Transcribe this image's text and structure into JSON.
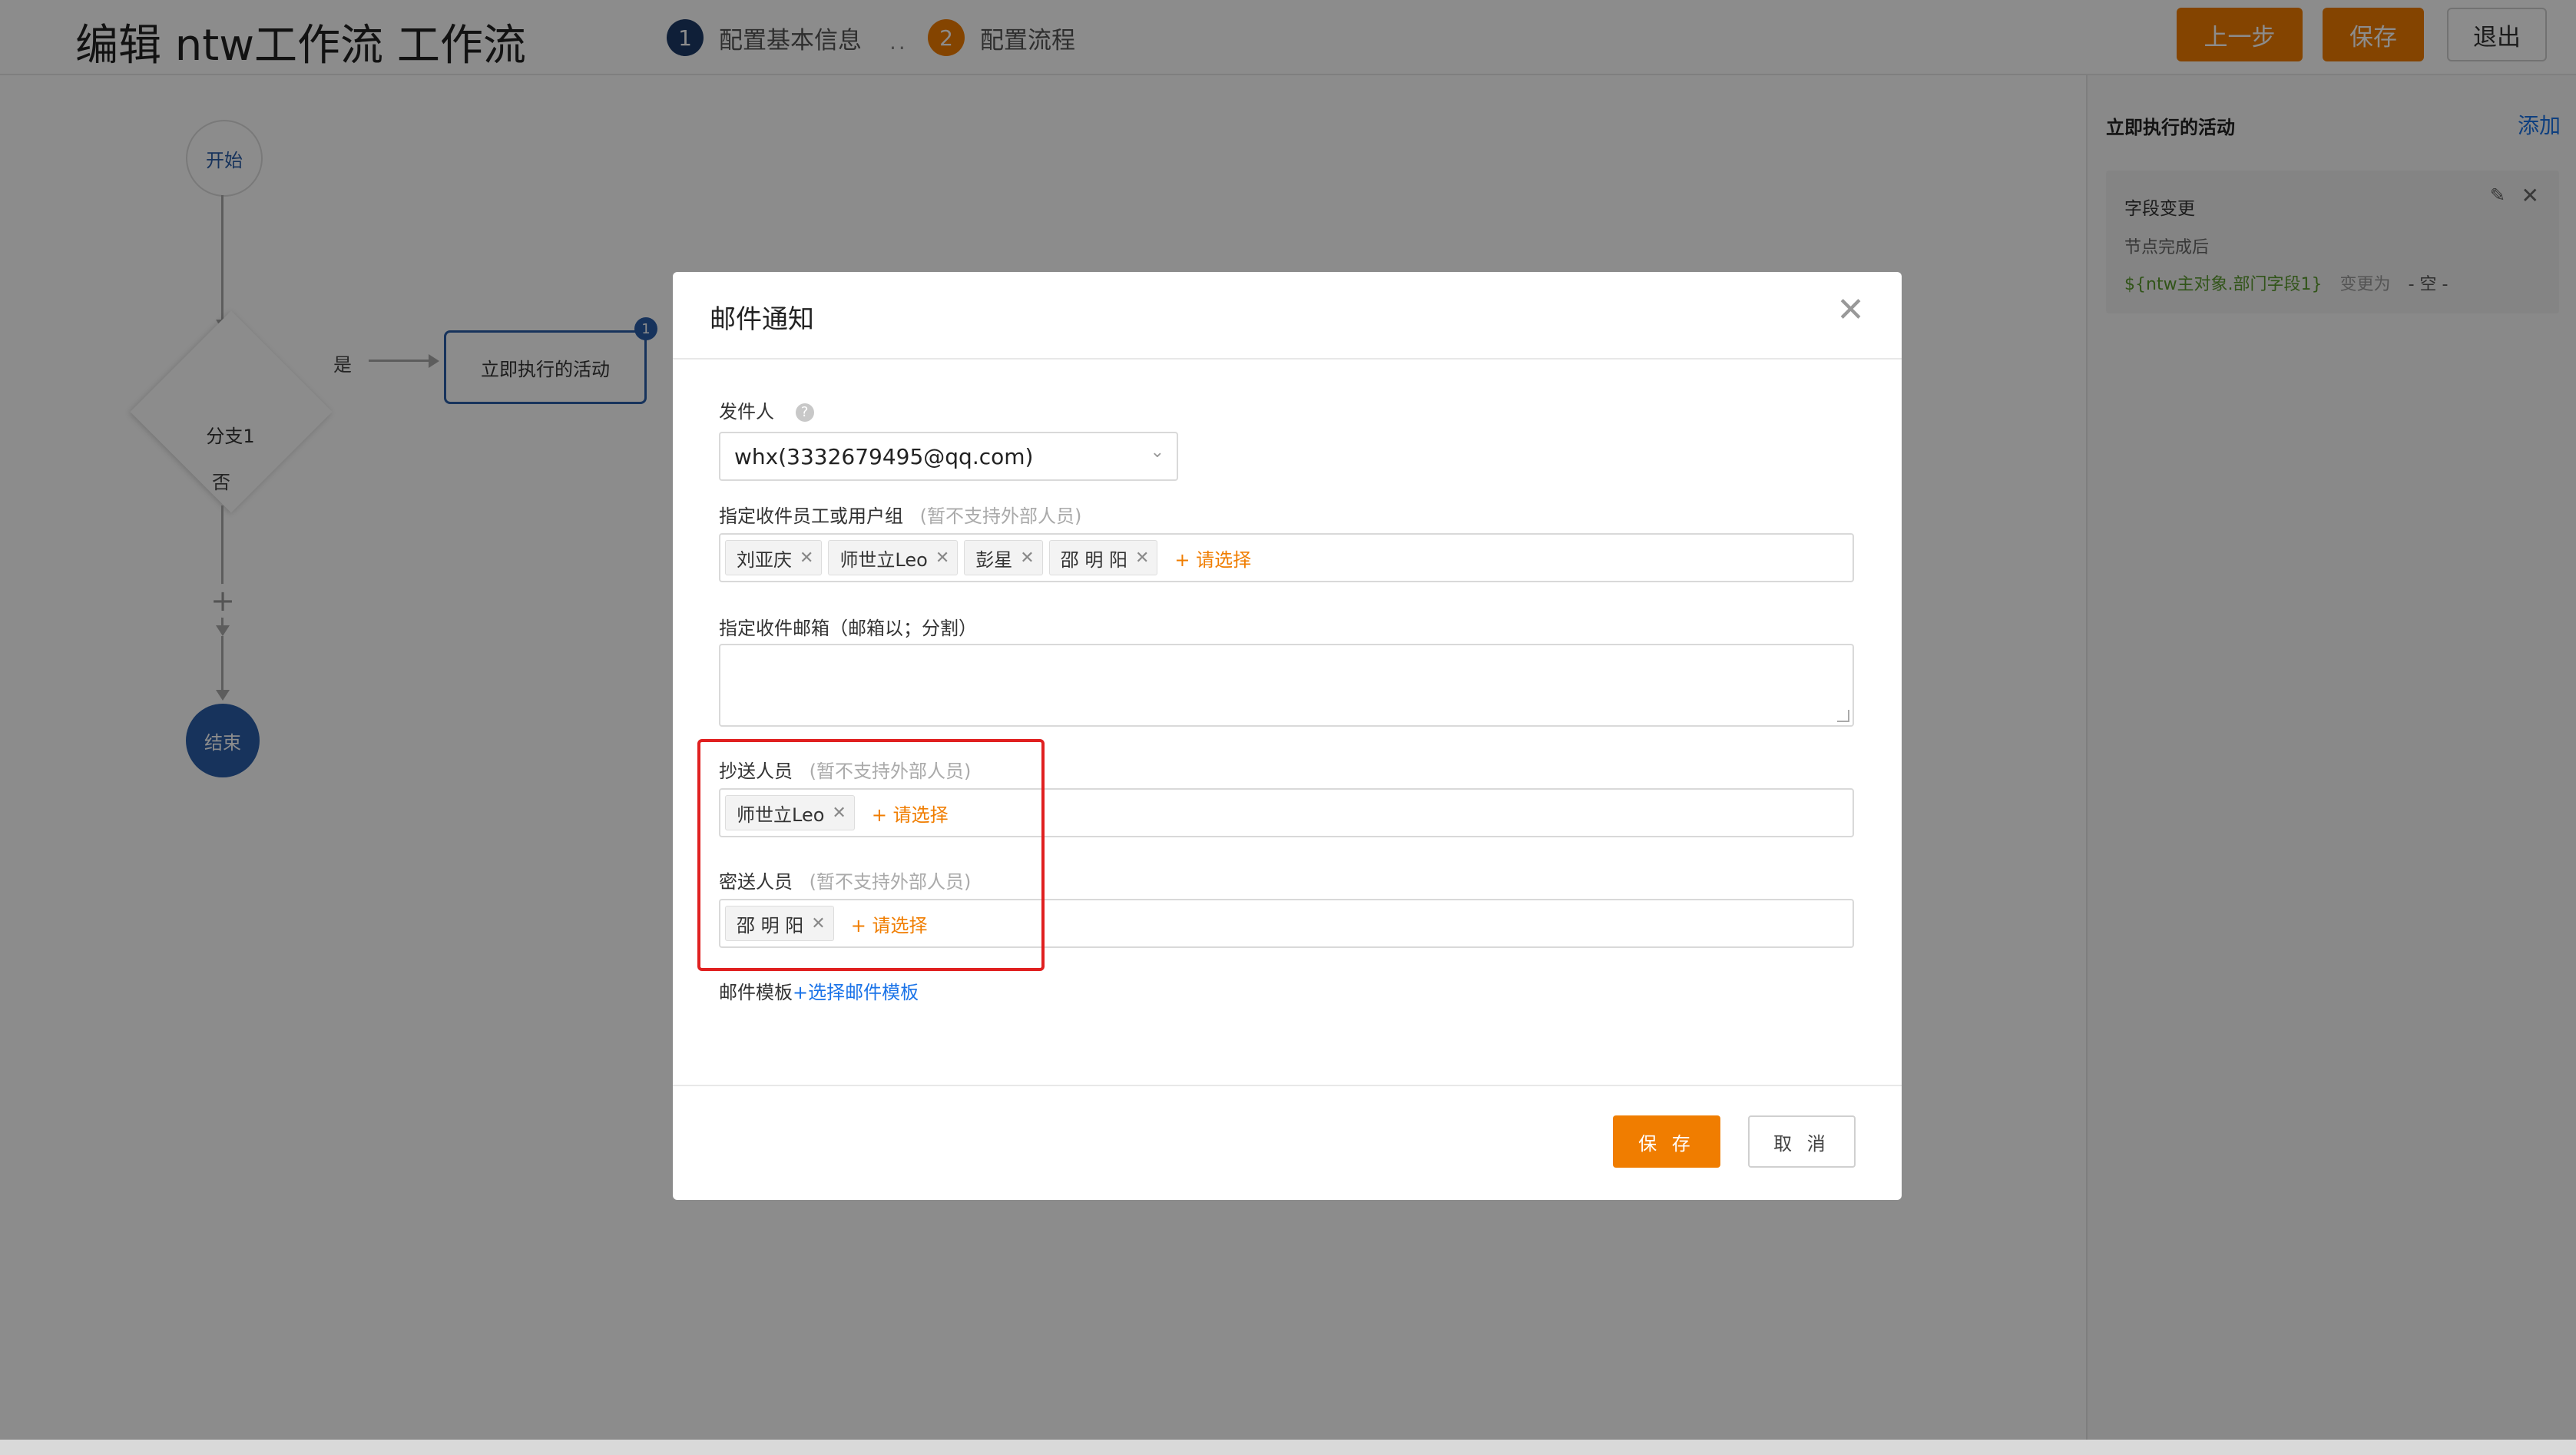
{
  "header": {
    "title": "编辑 ntw工作流 工作流",
    "steps": [
      {
        "num": "1",
        "label": "配置基本信息"
      },
      {
        "num": "2",
        "label": "配置流程"
      }
    ],
    "step_separator": "..",
    "buttons": {
      "prev": "上一步",
      "save": "保存",
      "exit": "退出"
    },
    "colors": {
      "accent": "#f07d00",
      "step_inactive": "#1d3a66",
      "step_active": "#f07d00"
    }
  },
  "flow": {
    "start": "开始",
    "branch": "分支1",
    "yes": "是",
    "no": "否",
    "action": "立即执行的活动",
    "action_badge": "1",
    "add": "+",
    "end": "结束"
  },
  "right_panel": {
    "title": "立即执行的活动",
    "add_label": "添加",
    "card": {
      "title": "字段变更",
      "subtitle": "节点完成后",
      "field": "${ntw主对象.部门字段1}",
      "operator": "变更为",
      "value": "- 空 -"
    }
  },
  "modal": {
    "title": "邮件通知",
    "sender": {
      "label": "发件人",
      "value": "whx(3332679495@qq.com)"
    },
    "recipients": {
      "label": "指定收件员工或用户组",
      "hint": "(暂不支持外部人员)",
      "tags": [
        "刘亚庆",
        "师世立Leo",
        "彭星",
        "邵 明 阳"
      ],
      "pick": "+ 请选择"
    },
    "emails": {
      "label": "指定收件邮箱（邮箱以；分割）",
      "value": ""
    },
    "cc": {
      "label": "抄送人员",
      "hint": "(暂不支持外部人员)",
      "tags": [
        "师世立Leo"
      ],
      "pick": "+ 请选择"
    },
    "bcc": {
      "label": "密送人员",
      "hint": "(暂不支持外部人员)",
      "tags": [
        "邵 明 阳"
      ],
      "pick": "+ 请选择"
    },
    "template": {
      "label": "邮件模板",
      "link": "+选择邮件模板"
    },
    "buttons": {
      "save": "保 存",
      "cancel": "取 消"
    }
  }
}
